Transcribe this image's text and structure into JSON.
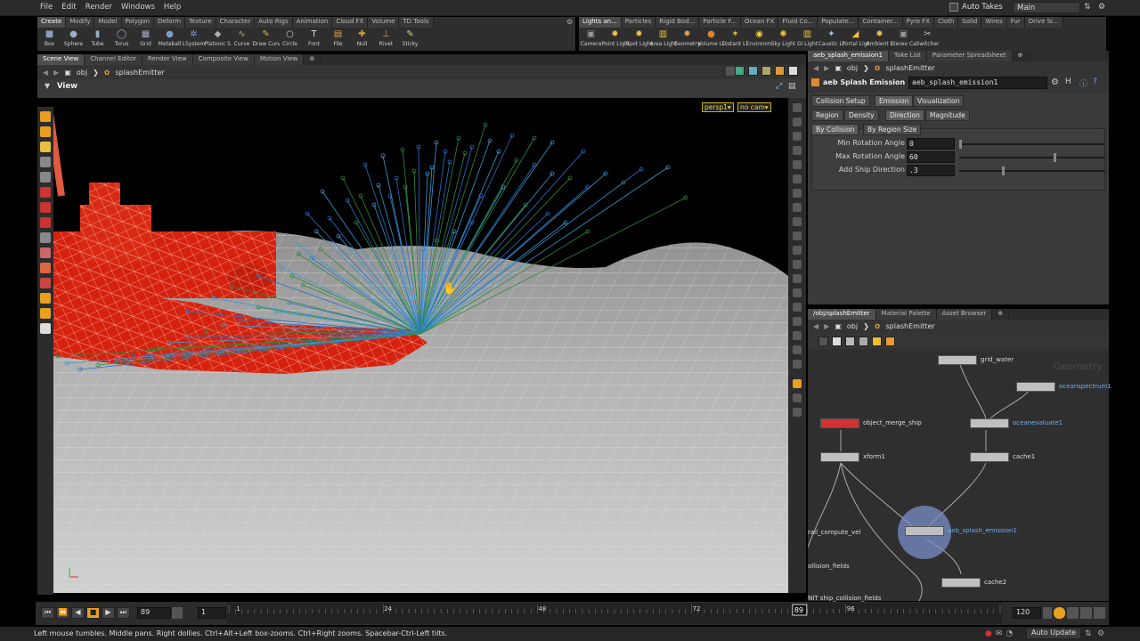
{
  "menu": {
    "items": [
      "File",
      "Edit",
      "Render",
      "Windows",
      "Help"
    ],
    "auto_takes": "Auto Takes",
    "desktop": "Main"
  },
  "shelf_left": {
    "tabs": [
      "Create",
      "Modify",
      "Model",
      "Polygon",
      "Deform",
      "Texture",
      "Character",
      "Auto Rigs",
      "Animation",
      "Cloud FX",
      "Volume",
      "TD Tools"
    ],
    "tools": [
      {
        "label": "Box",
        "icon": "box-icon",
        "glyph": "■",
        "color": "#8aa0b8"
      },
      {
        "label": "Sphere",
        "icon": "sphere-icon",
        "glyph": "●",
        "color": "#9bb0c8"
      },
      {
        "label": "Tube",
        "icon": "tube-icon",
        "glyph": "▮",
        "color": "#9bb0c8"
      },
      {
        "label": "Torus",
        "icon": "torus-icon",
        "glyph": "◯",
        "color": "#9bb0c8"
      },
      {
        "label": "Grid",
        "icon": "grid-icon",
        "glyph": "▦",
        "color": "#9bb0c8"
      },
      {
        "label": "Metaball",
        "icon": "metaball-icon",
        "glyph": "●",
        "color": "#7b9ad0"
      },
      {
        "label": "LSystem",
        "icon": "lsystem-icon",
        "glyph": "✲",
        "color": "#6fa0d8"
      },
      {
        "label": "Platonic S...",
        "icon": "platonic-icon",
        "glyph": "◆",
        "color": "#b0b0b0"
      },
      {
        "label": "Curve",
        "icon": "curve-icon",
        "glyph": "∿",
        "color": "#d8b050"
      },
      {
        "label": "Draw Curve",
        "icon": "draw-curve-icon",
        "glyph": "✎",
        "color": "#d8b050"
      },
      {
        "label": "Circle",
        "icon": "circle-icon",
        "glyph": "○",
        "color": "#cfcfcf"
      },
      {
        "label": "Font",
        "icon": "font-icon",
        "glyph": "T",
        "color": "#e0e0e0"
      },
      {
        "label": "File",
        "icon": "file-icon",
        "glyph": "▤",
        "color": "#e0a040"
      },
      {
        "label": "Null",
        "icon": "null-icon",
        "glyph": "✚",
        "color": "#e0a040"
      },
      {
        "label": "Rivet",
        "icon": "rivet-icon",
        "glyph": "⊥",
        "color": "#e0a040"
      },
      {
        "label": "Sticky",
        "icon": "sticky-icon",
        "glyph": "✎",
        "color": "#e0d080"
      }
    ]
  },
  "shelf_right": {
    "tabs": [
      "Lights an...",
      "Particles",
      "Rigid Bod...",
      "Particle F...",
      "Ocean FX",
      "Fluid Co...",
      "Populate...",
      "Container...",
      "Pyro FX",
      "Cloth",
      "Solid",
      "Wires",
      "Fur",
      "Drive Si..."
    ],
    "tools": [
      {
        "label": "Camera",
        "icon": "camera-icon",
        "glyph": "▣",
        "color": "#9a9a9a"
      },
      {
        "label": "Point Light",
        "icon": "point-light-icon",
        "glyph": "✹",
        "color": "#f0c040"
      },
      {
        "label": "Spot Light",
        "icon": "spot-light-icon",
        "glyph": "✹",
        "color": "#f0c040"
      },
      {
        "label": "Area Light",
        "icon": "area-light-icon",
        "glyph": "▥",
        "color": "#f0c040"
      },
      {
        "label": "Geometry...",
        "icon": "geometry-light-icon",
        "glyph": "✸",
        "color": "#f0a040"
      },
      {
        "label": "Volume Li...",
        "icon": "volume-light-icon",
        "glyph": "●",
        "color": "#e08030"
      },
      {
        "label": "Distant Li...",
        "icon": "distant-light-icon",
        "glyph": "✶",
        "color": "#f0c040"
      },
      {
        "label": "Environm...",
        "icon": "environment-light-icon",
        "glyph": "◉",
        "color": "#f0d040"
      },
      {
        "label": "Sky Light",
        "icon": "sky-light-icon",
        "glyph": "✺",
        "color": "#f0c040"
      },
      {
        "label": "GI Light",
        "icon": "gi-light-icon",
        "glyph": "▥",
        "color": "#f0c040"
      },
      {
        "label": "Caustic Li...",
        "icon": "caustic-light-icon",
        "glyph": "✦",
        "color": "#a0c0f0"
      },
      {
        "label": "Portal Light",
        "icon": "portal-light-icon",
        "glyph": "◢",
        "color": "#f0c040"
      },
      {
        "label": "Ambient L...",
        "icon": "ambient-light-icon",
        "glyph": "✹",
        "color": "#f0c040"
      },
      {
        "label": "Stereo Ca...",
        "icon": "stereo-camera-icon",
        "glyph": "▣",
        "color": "#9a9a9a"
      },
      {
        "label": "Switcher",
        "icon": "switcher-icon",
        "glyph": "✂",
        "color": "#c0c0c0"
      }
    ]
  },
  "left_pane": {
    "tabs": [
      "Scene View",
      "Channel Editor",
      "Render View",
      "Composite View",
      "Motion View"
    ],
    "path": [
      "obj",
      "splashEmitter"
    ],
    "view_label": "View",
    "camera_menu": "persp1",
    "cam_menu": "no cam"
  },
  "param_pane": {
    "tabs": [
      "aeb_splash_emission1",
      "Take List",
      "Parameter Spreadsheet"
    ],
    "path": [
      "obj",
      "splashEmitter"
    ],
    "node_type": "aeb Splash Emission",
    "node_name": "aeb_splash_emission1",
    "tabs_row1": [
      "Collision Setup",
      "Emission",
      "Visualization"
    ],
    "tabs_row2": [
      "Region",
      "Density",
      "Direction",
      "Magnitude"
    ],
    "tabs_row3": [
      "By Collision",
      "By Region Size"
    ],
    "params": [
      {
        "label": "Min Rotation Angle",
        "value": "0",
        "slider": 0.0
      },
      {
        "label": "Max Rotation Angle",
        "value": "60",
        "slider": 0.66
      },
      {
        "label": "Add Ship Direction",
        "value": ".3",
        "slider": 0.3
      }
    ]
  },
  "network_pane": {
    "tabs": [
      "/obj/splashEmitter",
      "Material Palette",
      "Asset Browser"
    ],
    "path": [
      "obj",
      "splashEmitter"
    ],
    "watermark": "Geometry",
    "nodes": [
      {
        "id": "grid_water",
        "label": "grid_water",
        "color": "#c0c0c0"
      },
      {
        "id": "oceanspectrum1",
        "label": "oceanspectrum1",
        "color": "#c0c0c0"
      },
      {
        "id": "object_merge_ship",
        "label": "object_merge_ship",
        "color": "#d03030"
      },
      {
        "id": "oceanevaluate1",
        "label": "oceanevaluate1",
        "color": "#c0c0c0"
      },
      {
        "id": "xform1",
        "label": "xform1",
        "color": "#c0c0c0"
      },
      {
        "id": "cache1",
        "label": "cache1",
        "color": "#c0c0c0"
      },
      {
        "id": "aeb_splash_emission1",
        "label": "aeb_splash_emission1",
        "color": "#c0c0c0"
      },
      {
        "id": "cache2",
        "label": "cache2",
        "color": "#c0c0c0"
      }
    ],
    "side_labels": [
      "rail_compute_vel",
      "ollision_fields",
      "NIT ship_collision_fields"
    ]
  },
  "timeline": {
    "current_frame": "89",
    "start_frame": "1",
    "end_frame": "120",
    "ticks": [
      "1",
      "24",
      "48",
      "72",
      "96",
      "1"
    ],
    "playhead_label": "89",
    "playhead_position": 0.74
  },
  "status": {
    "message": "Left mouse tumbles. Middle pans. Right dollies. Ctrl+Alt+Left box-zooms. Ctrl+Right zooms. Spacebar-Ctrl-Left tilts.",
    "update_mode": "Auto Update"
  }
}
